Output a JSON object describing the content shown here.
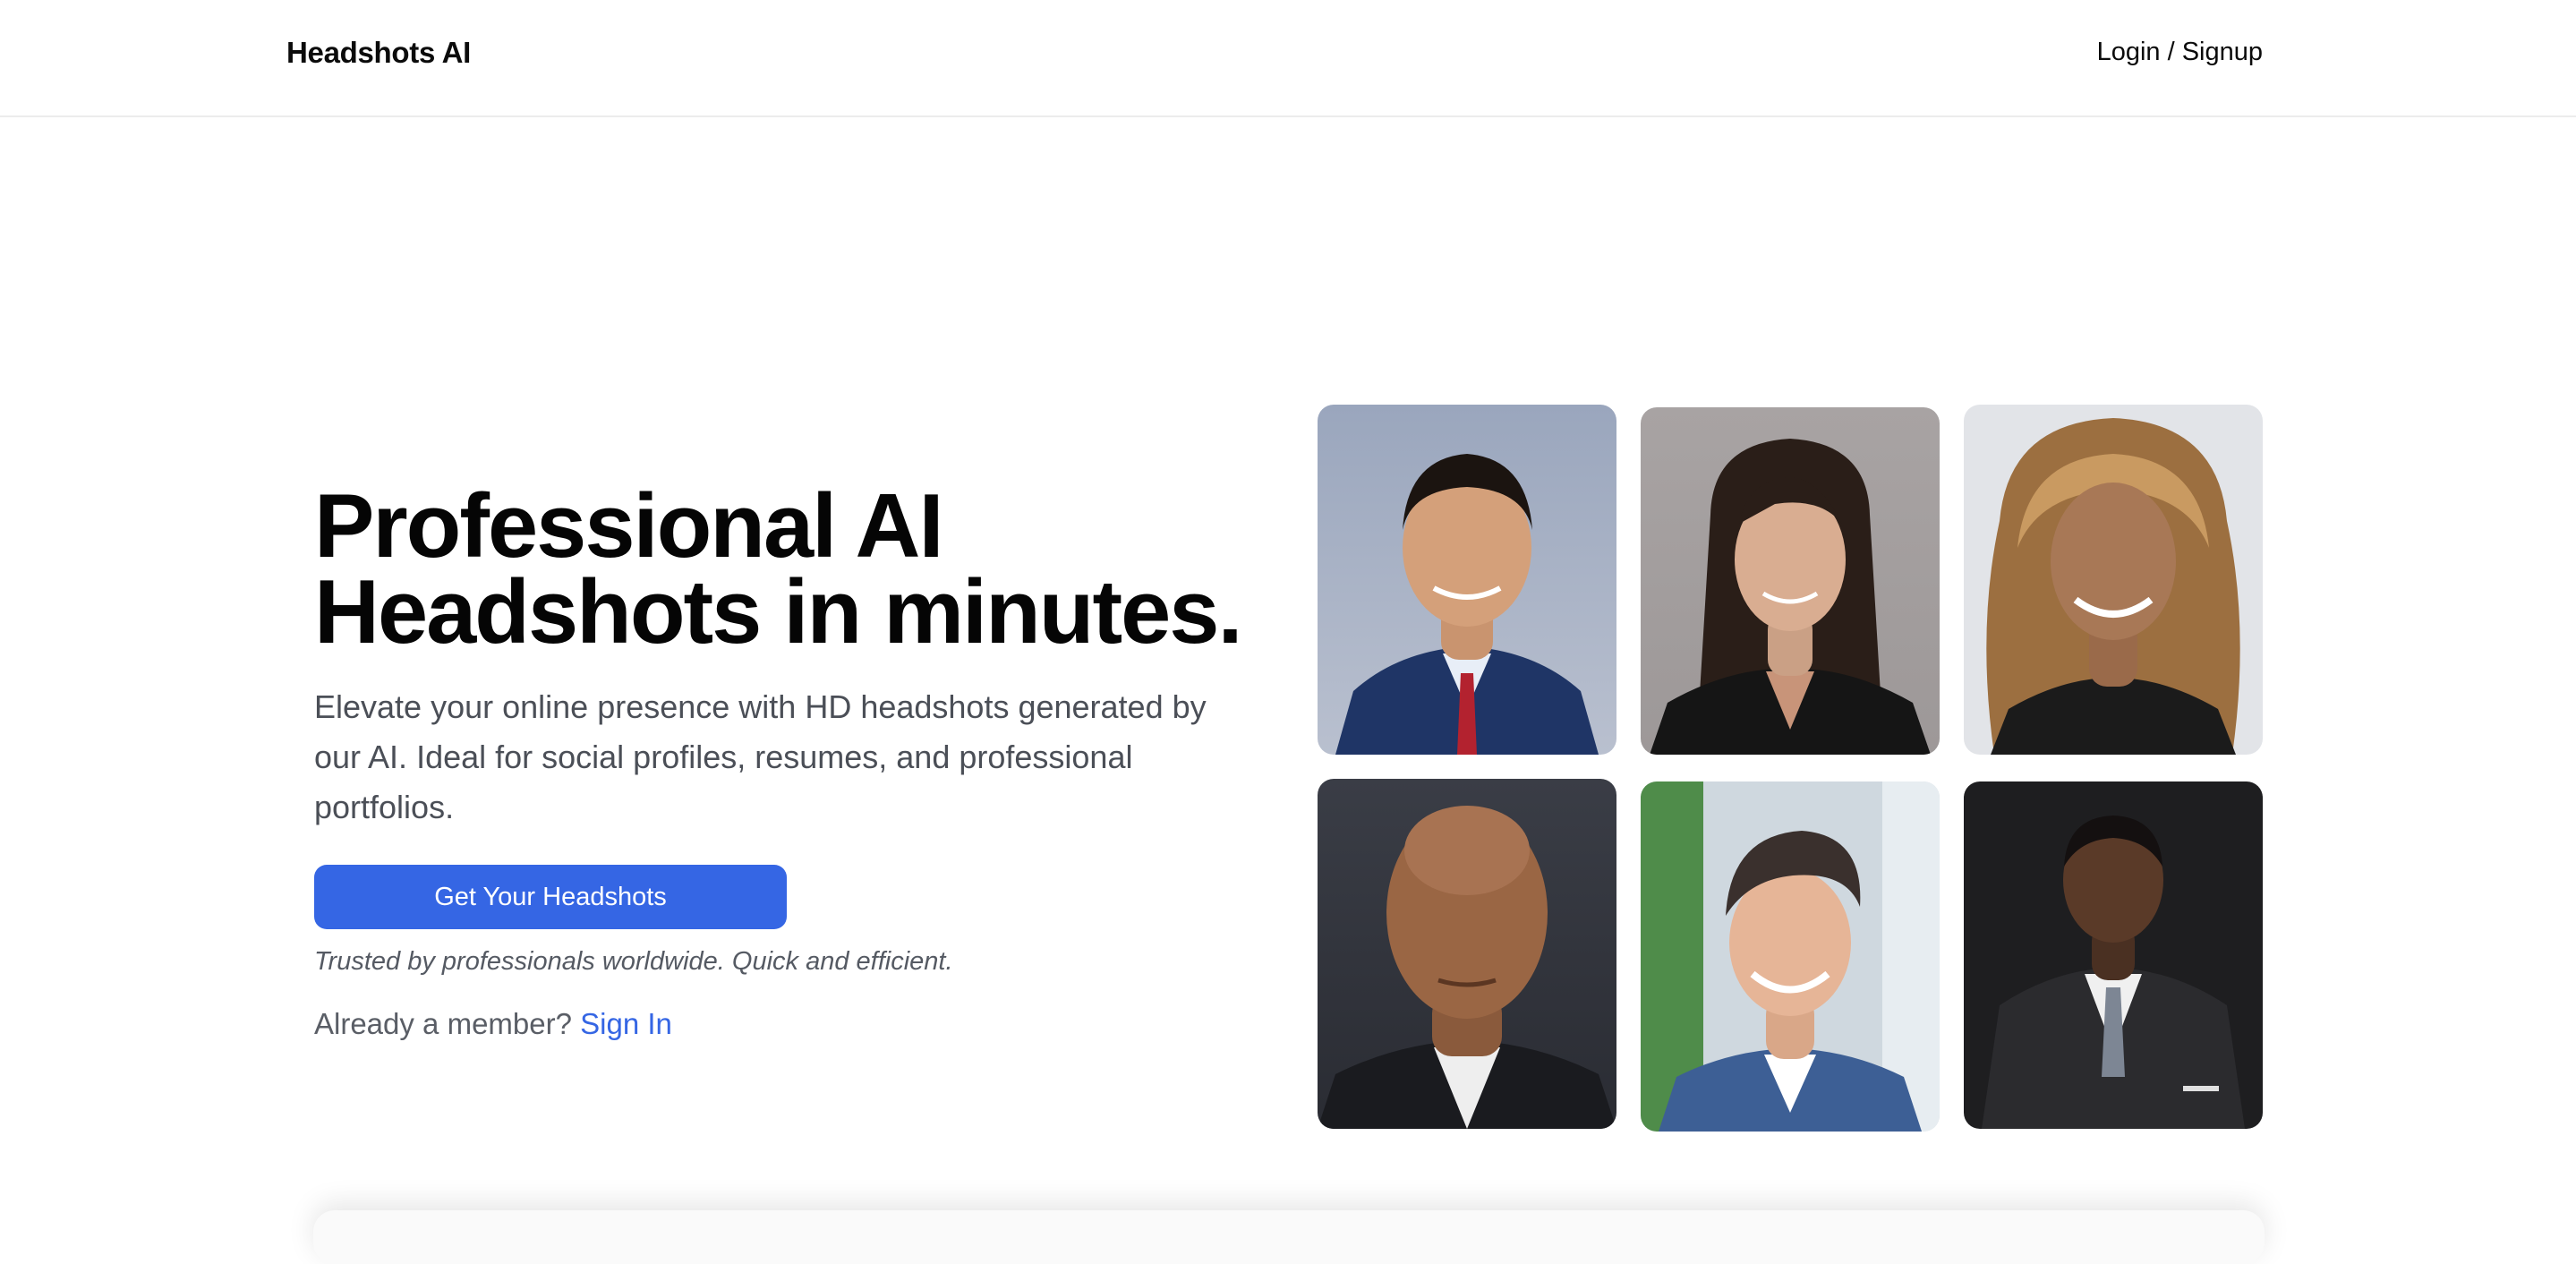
{
  "navbar": {
    "brand": "Headshots AI",
    "login_label": "Login / Signup"
  },
  "hero": {
    "headline_line1": "Professional AI",
    "headline_line2": "Headshots in minutes.",
    "description": "Elevate your online presence with HD headshots generated by our AI. Ideal for social profiles, resumes, and professional portfolios.",
    "cta_label": "Get Your Headshots",
    "trust_note": "Trusted by professionals worldwide. Quick and efficient.",
    "member_prompt": "Already a member?",
    "sign_in_label": "Sign In"
  },
  "colors": {
    "accent": "#3566e4",
    "text": "#050505",
    "muted": "#4b4f57"
  }
}
